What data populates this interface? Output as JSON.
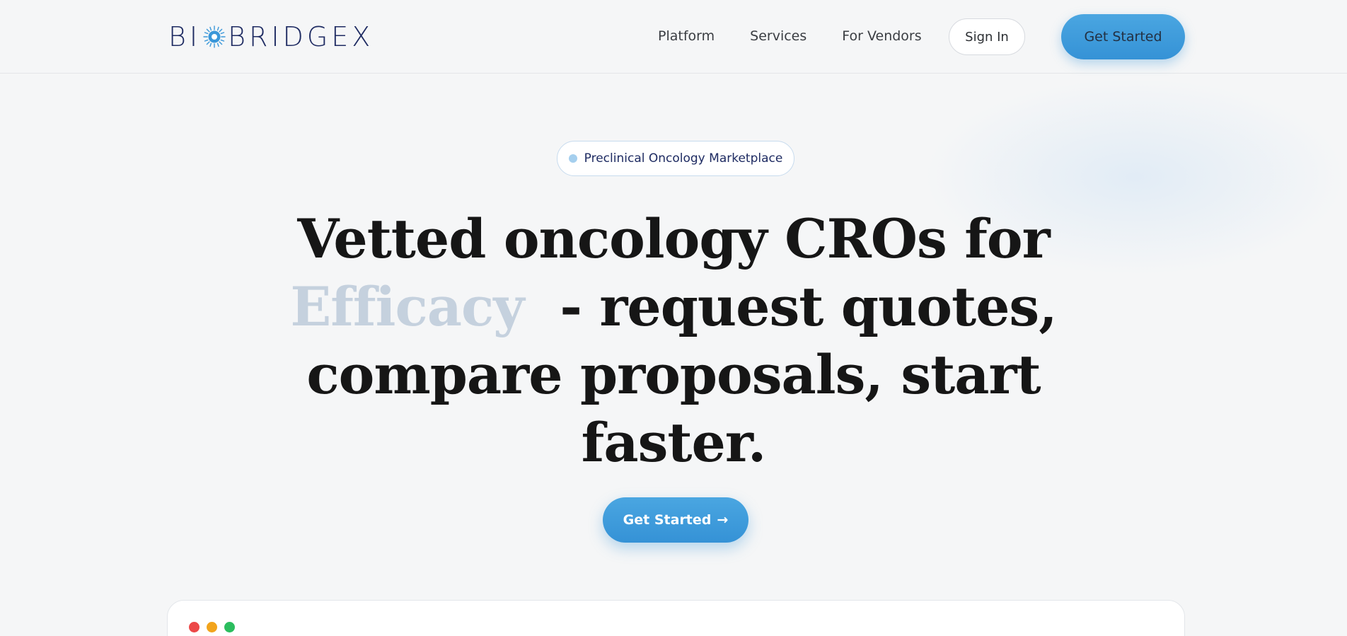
{
  "brand": {
    "name_part1": "BI",
    "name_part2": "BRIDGEX",
    "accent": "#3a97d9",
    "navy": "#1e2b62"
  },
  "nav": {
    "items": [
      {
        "label": "Platform"
      },
      {
        "label": "Services"
      },
      {
        "label": "For Vendors"
      }
    ],
    "sign_in": "Sign In",
    "get_started": "Get Started"
  },
  "hero": {
    "badge": "Preclinical Oncology Marketplace",
    "headline_line1": "Vetted oncology CROs for",
    "headline_highlight": "Efficacy",
    "headline_rest1": "- request quotes,",
    "headline_line3": "compare proposals, start",
    "headline_line4": "faster.",
    "cta_label": "Get Started",
    "cta_arrow": "→"
  },
  "preview": {
    "window_controls": [
      "close",
      "minimize",
      "maximize"
    ]
  }
}
